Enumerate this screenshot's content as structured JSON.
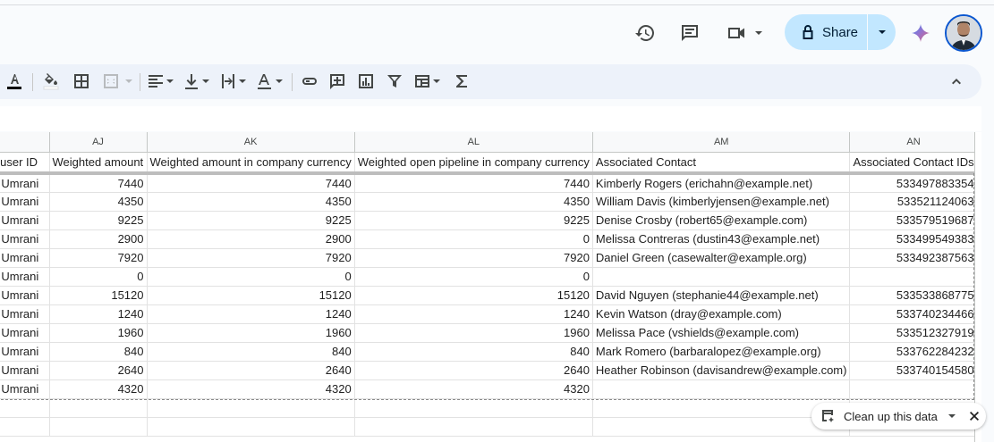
{
  "header": {
    "share_label": "Share"
  },
  "columns": [
    "AJ",
    "AK",
    "AL",
    "AM",
    "AN"
  ],
  "table": {
    "headers": [
      "y user ID",
      "Weighted amount",
      "Weighted amount in company currency",
      "Weighted open pipeline in company currency",
      "Associated Contact",
      "Associated Contact IDs"
    ],
    "rows": [
      [
        "li Umrani",
        "7440",
        "7440",
        "7440",
        "Kimberly Rogers (erichahn@example.net)",
        "533497883354"
      ],
      [
        "li Umrani",
        "4350",
        "4350",
        "4350",
        "William Davis (kimberlyjensen@example.net)",
        "533521124063"
      ],
      [
        "li Umrani",
        "9225",
        "9225",
        "9225",
        "Denise Crosby (robert65@example.com)",
        "533579519687"
      ],
      [
        "li Umrani",
        "2900",
        "2900",
        "0",
        "Melissa Contreras (dustin43@example.net)",
        "533499549383"
      ],
      [
        "li Umrani",
        "7920",
        "7920",
        "7920",
        "Daniel Green (casewalter@example.org)",
        "533492387563"
      ],
      [
        "li Umrani",
        "0",
        "0",
        "0",
        "",
        ""
      ],
      [
        "li Umrani",
        "15120",
        "15120",
        "15120",
        "David Nguyen (stephanie44@example.net)",
        "533533868775"
      ],
      [
        "li Umrani",
        "1240",
        "1240",
        "1240",
        "Kevin Watson (dray@example.com)",
        "533740234466"
      ],
      [
        "li Umrani",
        "1960",
        "1960",
        "1960",
        "Melissa Pace (vshields@example.com)",
        "533512327919"
      ],
      [
        "li Umrani",
        "840",
        "840",
        "840",
        "Mark Romero (barbaralopez@example.org)",
        "533762284232"
      ],
      [
        "li Umrani",
        "2640",
        "2640",
        "2640",
        "Heather Robinson (davisandrew@example.com)",
        "533740154580"
      ],
      [
        "li Umrani",
        "4320",
        "4320",
        "4320",
        "",
        ""
      ]
    ]
  },
  "cleanup": {
    "label": "Clean up this data"
  },
  "colors": {
    "share_bg": "#c2e7ff",
    "toolbar_bg": "#edf2fa",
    "selection": "#0b57d0"
  }
}
